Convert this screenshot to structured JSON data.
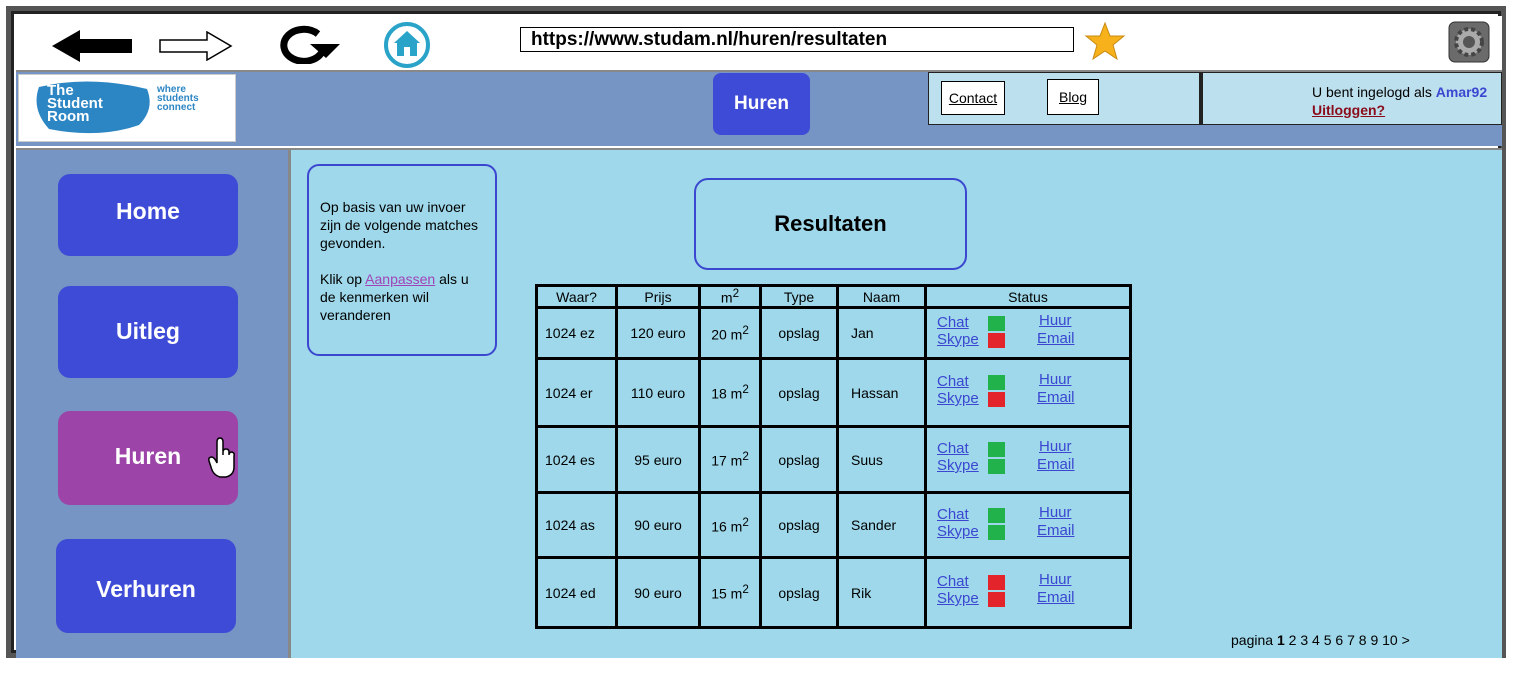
{
  "browser": {
    "url": "https://www.studam.nl/huren/resultaten",
    "back_icon": "back-arrow-icon",
    "forward_icon": "forward-arrow-icon",
    "reload_icon": "reload-icon",
    "home_icon": "home-icon",
    "bookmark_icon": "star-icon",
    "settings_icon": "gear-icon"
  },
  "header": {
    "logo_line1": "The",
    "logo_line2": "Student",
    "logo_line3": "Room",
    "logo_tag1": "where",
    "logo_tag2": "students",
    "logo_tag3": "connect",
    "active_section": "Huren",
    "contact_label": "Contact",
    "blog_label": "Blog",
    "login_text": "U bent ingelogd als",
    "username": "Amar92",
    "logout_label": "Uitloggen?"
  },
  "sidebar": {
    "items": [
      {
        "label": "Home"
      },
      {
        "label": "Uitleg"
      },
      {
        "label": "Huren"
      },
      {
        "label": "Verhuren"
      }
    ]
  },
  "main": {
    "info_text1": "Op basis van uw invoer zijn de volgende matches gevonden.",
    "info_text2a": "Klik op",
    "info_link": "Aanpassen",
    "info_text2b": "als u de kenmerken wil veranderen",
    "title": "Resultaten",
    "table": {
      "headers": [
        "Waar?",
        "Prijs",
        "m",
        "Type",
        "Naam",
        "Status"
      ],
      "header_sup": "2",
      "rows": [
        {
          "waar": "1024 ez",
          "prijs": "120 euro",
          "m2": "20 m",
          "type": "opslag",
          "naam": "Jan",
          "chat": "Chat",
          "skype": "Skype",
          "huur": "Huur",
          "email": "Email",
          "chat_status": "green",
          "skype_status": "red"
        },
        {
          "waar": "1024 er",
          "prijs": "110 euro",
          "m2": "18 m",
          "type": "opslag",
          "naam": "Hassan",
          "chat": "Chat",
          "skype": "Skype",
          "huur": "Huur",
          "email": "Email",
          "chat_status": "green",
          "skype_status": "red"
        },
        {
          "waar": "1024 es",
          "prijs": "95 euro",
          "m2": "17 m",
          "type": "opslag",
          "naam": "Suus",
          "chat": "Chat",
          "skype": "Skype",
          "huur": "Huur",
          "email": "Email",
          "chat_status": "green",
          "skype_status": "green"
        },
        {
          "waar": "1024 as",
          "prijs": "90 euro",
          "m2": "16 m",
          "type": "opslag",
          "naam": "Sander",
          "chat": "Chat",
          "skype": "Skype",
          "huur": "Huur",
          "email": "Email",
          "chat_status": "green",
          "skype_status": "green"
        },
        {
          "waar": "1024 ed",
          "prijs": "90 euro",
          "m2": "15 m",
          "type": "opslag",
          "naam": "Rik",
          "chat": "Chat",
          "skype": "Skype",
          "huur": "Huur",
          "email": "Email",
          "chat_status": "red",
          "skype_status": "red"
        }
      ]
    },
    "pagination": {
      "label": "pagina",
      "current": "1",
      "pages": [
        "2",
        "3",
        "4",
        "5",
        "6",
        "7",
        "8",
        "9",
        "10"
      ],
      "next": ">"
    }
  },
  "colors": {
    "nav_button": "#3e4bd6",
    "nav_active": "#9c44a8",
    "panel_bg": "#7694c4",
    "content_bg": "#9ed8ea",
    "status_online": "#21b24c",
    "status_offline": "#e3242b"
  }
}
